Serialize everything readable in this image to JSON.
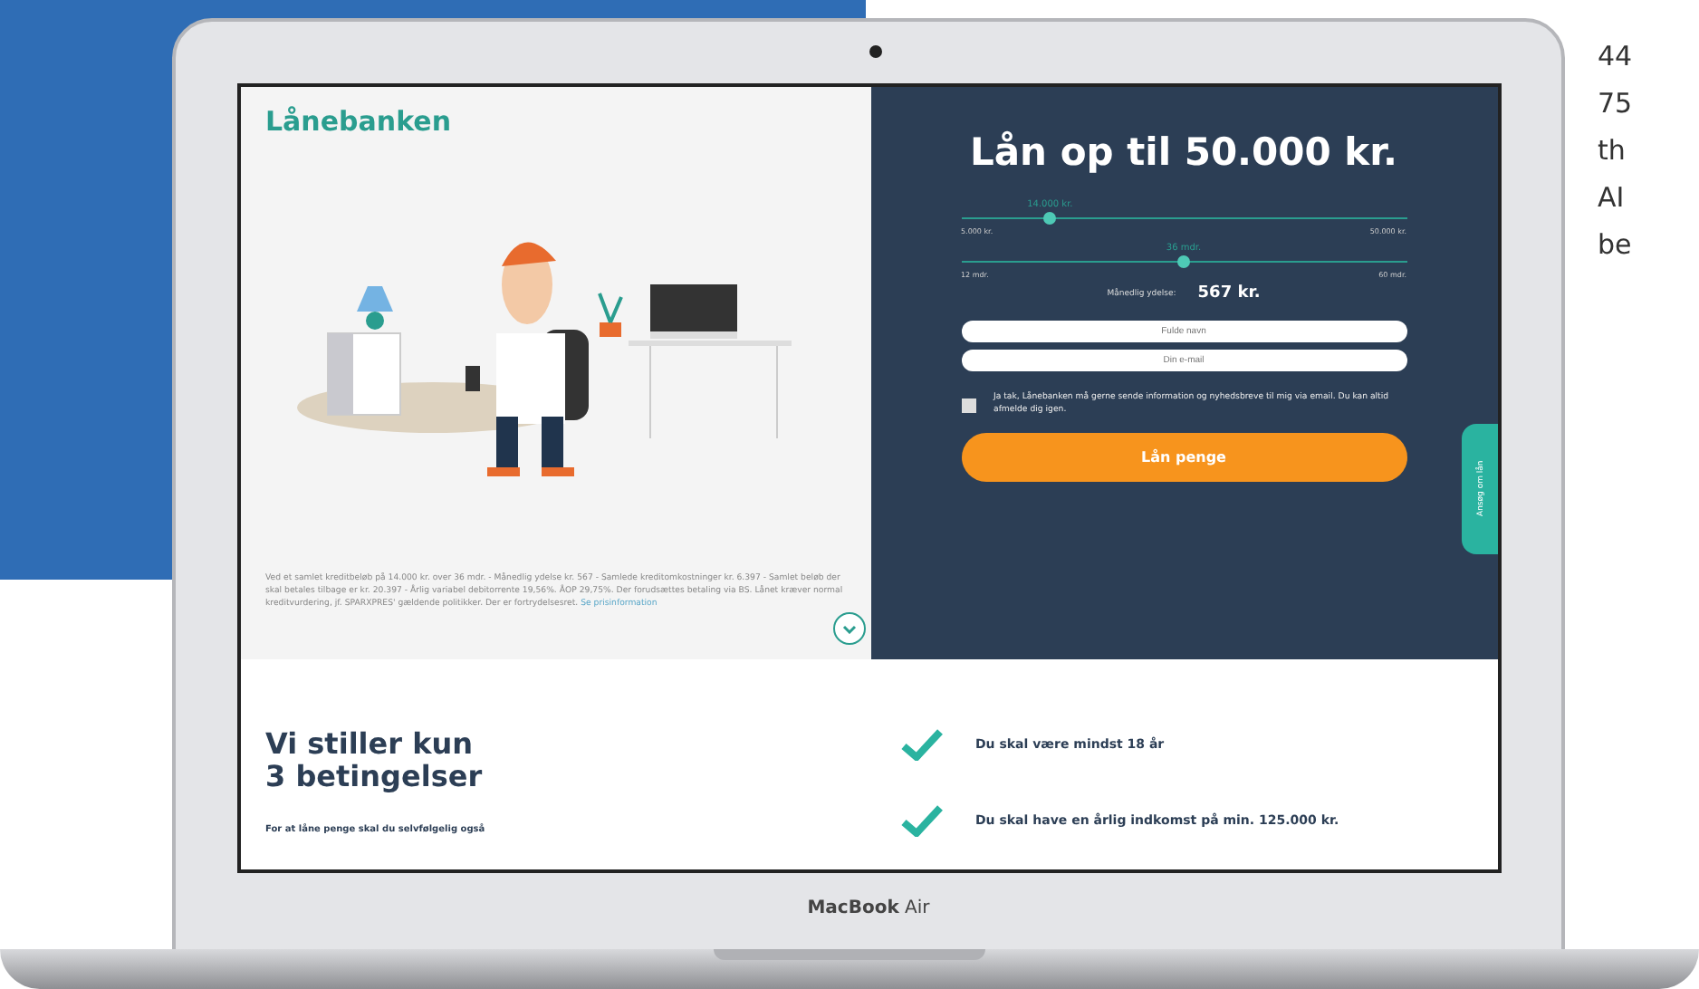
{
  "brand": {
    "logo": "Lånebanken"
  },
  "hero": {
    "title": "Lån op til 50.000 kr.",
    "sliders": [
      {
        "value_label": "14.000 kr.",
        "min_label": "5.000 kr.",
        "max_label": "50.000 kr.",
        "level": 0.2
      },
      {
        "value_label": "36 mdr.",
        "min_label": "12 mdr.",
        "max_label": "60 mdr.",
        "level": 0.5
      }
    ],
    "monthly": {
      "label": "Månedlig ydelse:",
      "value": "567 kr."
    },
    "fields": [
      {
        "placeholder": "Fulde navn"
      },
      {
        "placeholder": "Din e-mail"
      }
    ],
    "consent": {
      "checked": false,
      "text": "Ja tak, Lånebanken må gerne sende information og nyhedsbreve til mig via email. Du kan altid afmelde dig igen."
    },
    "submit": "Lån penge",
    "side_tab": "Ansøg om lån"
  },
  "disclaimer": {
    "text": "Ved et samlet kreditbeløb på 14.000 kr. over 36 mdr. - Månedlig ydelse kr. 567 - Samlede kreditomkostninger kr. 6.397 - Samlet beløb der skal betales tilbage er kr. 20.397 - Årlig variabel debitorrente 19,56%. ÅOP 29,75%. Der forudsættes betaling via BS. Lånet kræver normal kreditvurdering, jf. SPARXPRES' gældende politikker. Der er fortrydelsesret.",
    "link": "Se prisinformation"
  },
  "conditions": {
    "title_lines": [
      "Vi stiller kun",
      "3 betingelser"
    ],
    "intro": "For at låne penge skal du selvfølgelig også",
    "items": [
      "Du skal være mindst 18 år",
      "Du skal have en årlig indkomst på min. 125.000 kr."
    ]
  },
  "device_label": "**MacBook** Air",
  "side_text": [
    "44",
    "75",
    "th",
    "AI",
    "be"
  ]
}
